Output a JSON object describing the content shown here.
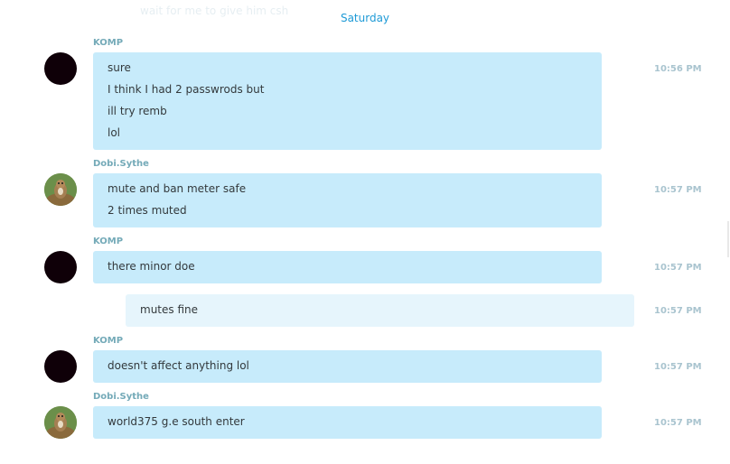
{
  "chat": {
    "faded_previous_message": "wait for me to give him csh",
    "date_separator": "Saturday",
    "groups": [
      {
        "sender": "KOMP",
        "messages": [
          "sure",
          "I think I had 2 passwrods but",
          "ill try remb",
          "lol"
        ],
        "time": "10:56 PM"
      },
      {
        "sender": "Dobi.Sythe",
        "messages": [
          "mute and ban meter safe",
          "2 times muted"
        ],
        "time": "10:57 PM"
      },
      {
        "sender": "KOMP",
        "messages": [
          "there minor doe"
        ],
        "time": "10:57 PM"
      },
      {
        "sender": "",
        "outgoing": true,
        "messages": [
          "mutes fine"
        ],
        "time": "10:57 PM"
      },
      {
        "sender": "KOMP",
        "messages": [
          "doesn't affect anything lol"
        ],
        "time": "10:57 PM"
      },
      {
        "sender": "Dobi.Sythe",
        "messages": [
          "world375 g.e south enter"
        ],
        "time": "10:57 PM"
      }
    ]
  },
  "colors": {
    "incoming_bubble": "#c7ebfb",
    "outgoing_bubble": "#e6f5fc",
    "sender_name": "#74aab8",
    "timestamp": "#a9c4cf",
    "date_separator": "#1e9ad6",
    "dark_avatar": "#0f0008"
  },
  "icons": {
    "komp_avatar": "dark-circle-avatar",
    "dobi_avatar": "squirrel-photo-avatar"
  }
}
